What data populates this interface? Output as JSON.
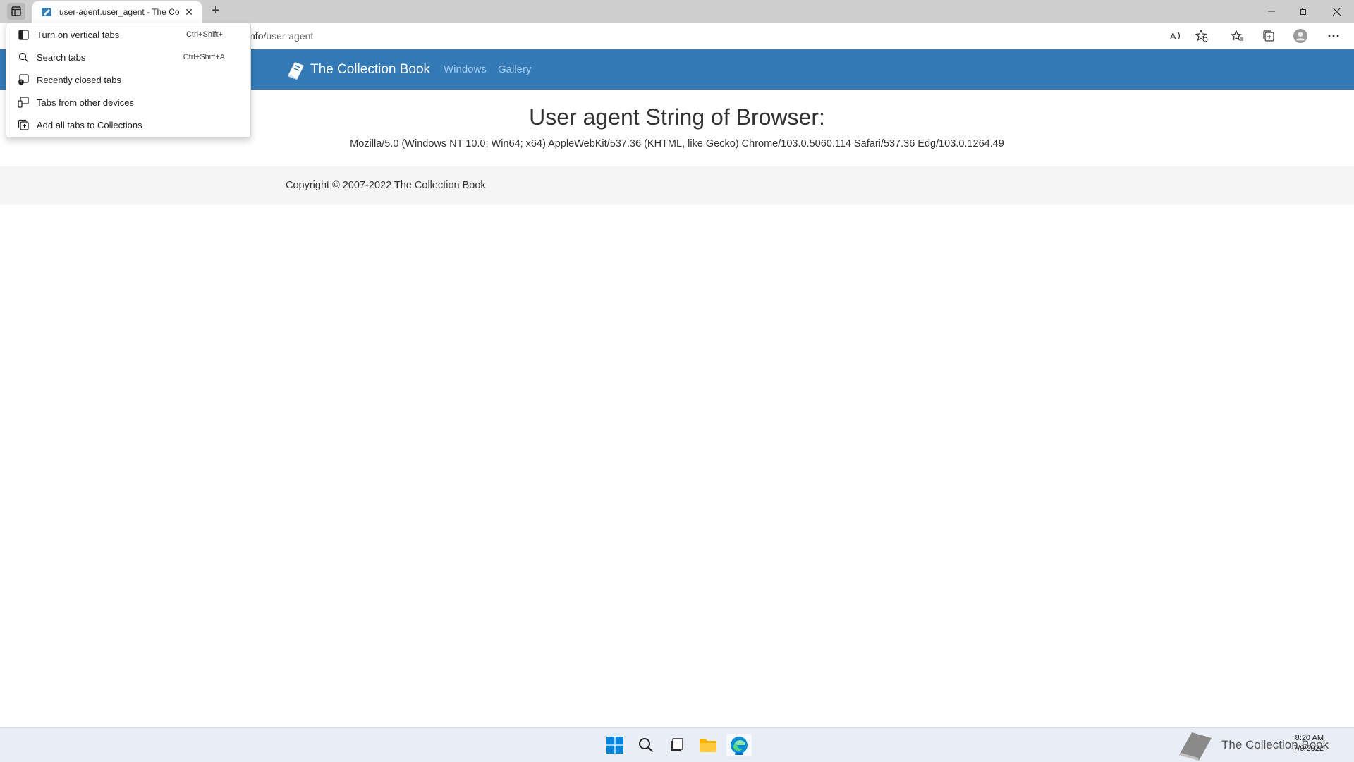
{
  "browser": {
    "tab_title": "user-agent.user_agent - The Collection Book",
    "url_prefix": "",
    "url_host_tail": "nfo",
    "url_path": "/user-agent"
  },
  "tab_menu": {
    "items": [
      {
        "label": "Turn on vertical tabs",
        "shortcut": "Ctrl+Shift+,"
      },
      {
        "label": "Search tabs",
        "shortcut": "Ctrl+Shift+A"
      },
      {
        "label": "Recently closed tabs",
        "shortcut": ""
      },
      {
        "label": "Tabs from other devices",
        "shortcut": ""
      },
      {
        "label": "Add all tabs to Collections",
        "shortcut": ""
      }
    ]
  },
  "site": {
    "brand": "The Collection Book",
    "nav": [
      "Windows",
      "Gallery"
    ],
    "heading": "User agent String of Browser:",
    "ua_string": "Mozilla/5.0 (Windows NT 10.0; Win64; x64) AppleWebKit/537.36 (KHTML, like Gecko) Chrome/103.0.5060.114 Safari/537.36 Edg/103.0.1264.49",
    "copyright": "Copyright © 2007-2022 The Collection Book"
  },
  "taskbar": {
    "tray_watermark": "The Collection Book",
    "time": "8:20 AM",
    "date": "7/9/2022"
  },
  "colors": {
    "navbar": "#337ab7",
    "nav_link": "#a8cbee",
    "taskbar": "#e9eef6"
  }
}
